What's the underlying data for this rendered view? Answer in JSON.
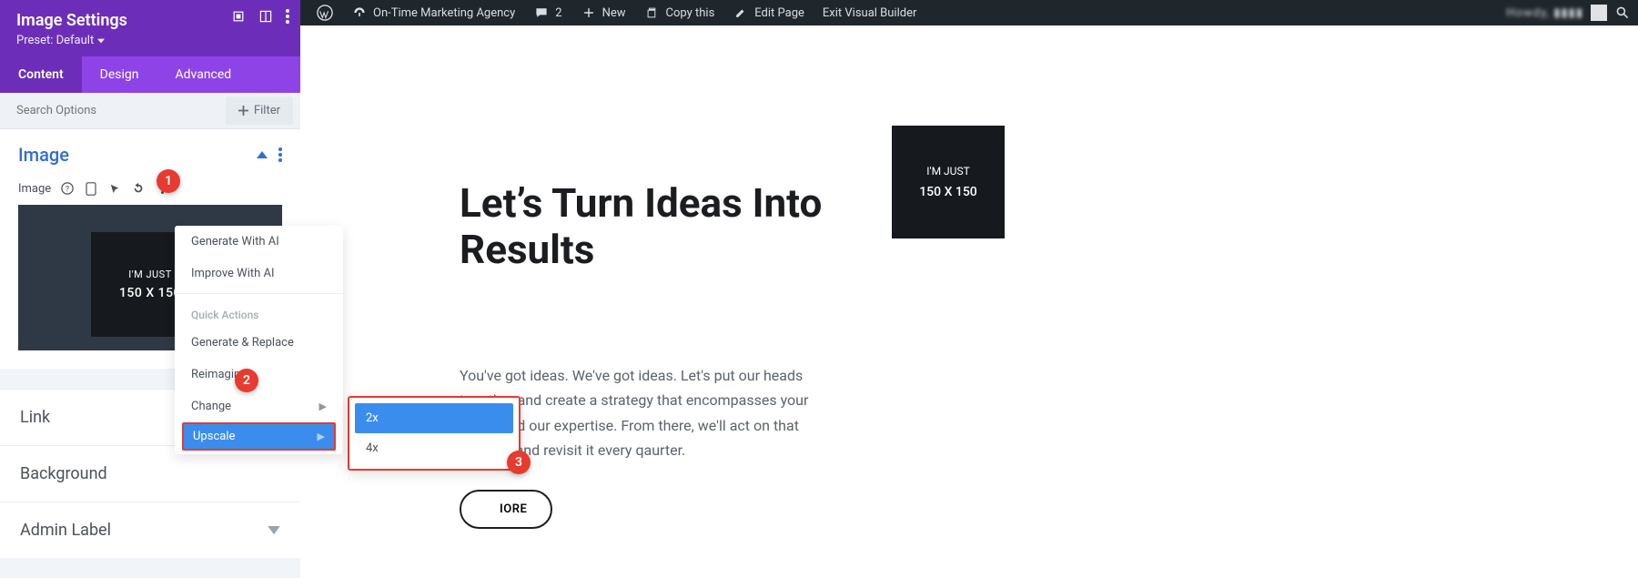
{
  "adminbar": {
    "site_name": "On-Time Marketing Agency",
    "comments_count": "2",
    "new_label": "New",
    "copy_label": "Copy this",
    "edit_page_label": "Edit Page",
    "exit_vb_label": "Exit Visual Builder",
    "greeting_blurred": "Howdy, ▮▮▮▮"
  },
  "panel": {
    "title": "Image Settings",
    "preset_label": "Preset: Default",
    "tabs": {
      "content": "Content",
      "design": "Design",
      "advanced": "Advanced"
    },
    "search_placeholder": "Search Options",
    "filter_label": "Filter"
  },
  "image_section": {
    "title": "Image",
    "field_label": "Image",
    "placeholder_l1": "I'M JUST",
    "placeholder_l2": "150 X 150"
  },
  "menu": {
    "generate_ai": "Generate With AI",
    "improve_ai": "Improve With AI",
    "quick_actions_header": "Quick Actions",
    "generate_replace": "Generate & Replace",
    "reimagine": "Reimagine",
    "change": "Change",
    "upscale": "Upscale"
  },
  "submenu": {
    "x2": "2x",
    "x4": "4x"
  },
  "collapsed": {
    "link": "Link",
    "background": "Background",
    "admin_label": "Admin Label"
  },
  "badges": {
    "b1": "1",
    "b2": "2",
    "b3": "3"
  },
  "hero": {
    "heading": "Let’s Turn Ideas Into Results",
    "body": "You've got ideas. We've got ideas. Let's put our heads together and create a strategy that encompasses your vision and our expertise. From there, we'll act on that strategy and revisit it every qaurter.",
    "cta": "IORE"
  },
  "right_img": {
    "l1": "I'M JUST",
    "l2": "150 X 150"
  }
}
